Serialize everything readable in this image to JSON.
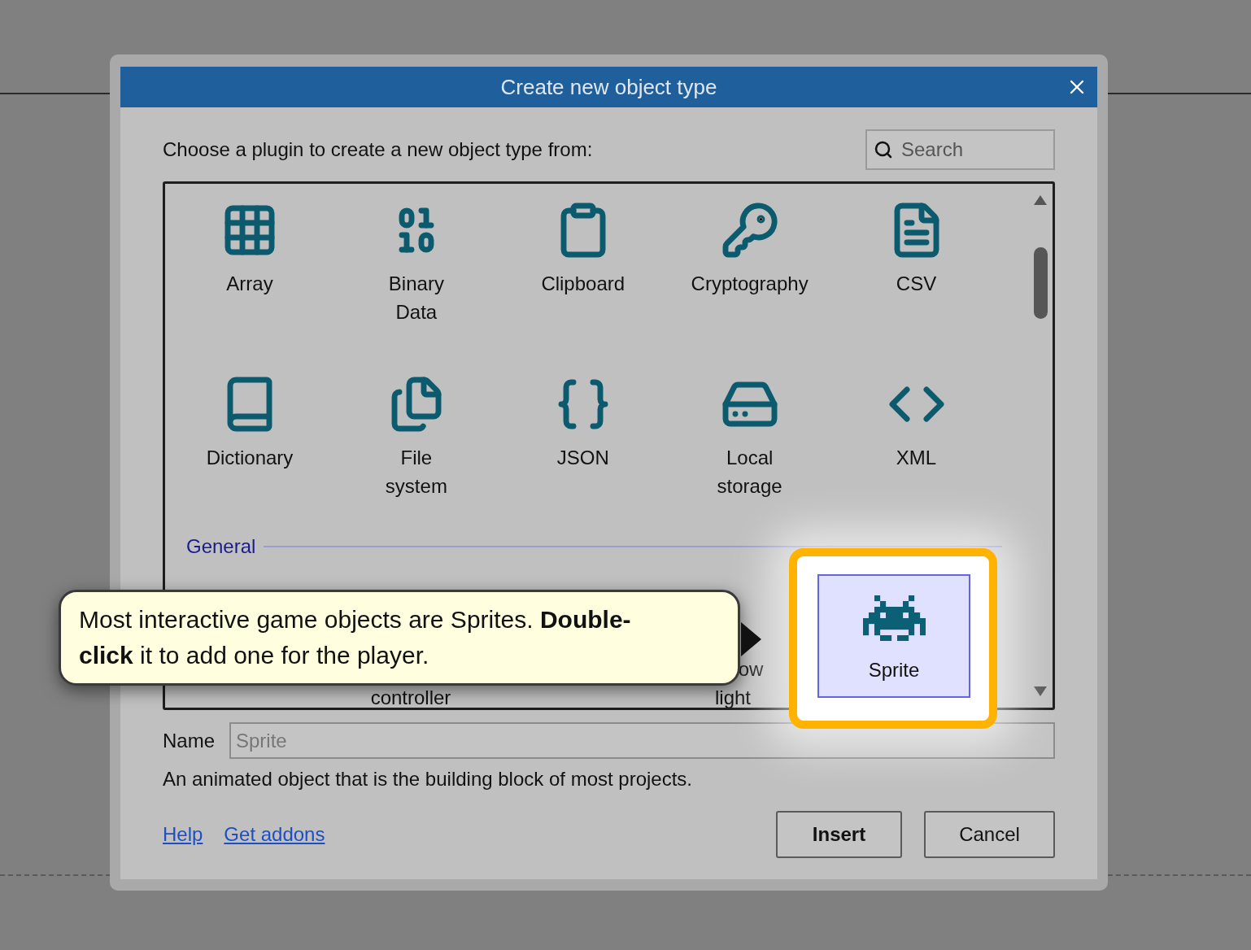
{
  "dialog": {
    "title": "Create new object type",
    "prompt": "Choose a plugin to create a new object type from:",
    "search": {
      "placeholder": "Search"
    },
    "plugins": [
      {
        "lines": [
          "Array"
        ]
      },
      {
        "lines": [
          "Binary",
          "Data"
        ]
      },
      {
        "lines": [
          "Clipboard"
        ]
      },
      {
        "lines": [
          "Cryptography"
        ]
      },
      {
        "lines": [
          "CSV"
        ]
      },
      {
        "lines": [
          "Dictionary"
        ]
      },
      {
        "lines": [
          "File",
          "system"
        ]
      },
      {
        "lines": [
          "JSON"
        ]
      },
      {
        "lines": [
          "Local",
          "storage"
        ]
      },
      {
        "lines": [
          "XML"
        ]
      }
    ],
    "general": {
      "heading": "General",
      "items": [
        {
          "kind": "covered",
          "lines": [
            "controller"
          ]
        },
        {
          "kind": "covered",
          "lines": [
            "ow",
            "light"
          ]
        },
        {
          "kind": "plugin",
          "lines": [
            "Sprite"
          ],
          "selected": true
        }
      ]
    },
    "name": {
      "label": "Name",
      "value": "Sprite"
    },
    "description": "An animated object that is the building block of most projects.",
    "links": [
      "Help",
      "Get addons"
    ],
    "buttons": [
      {
        "label": "Insert",
        "default": true
      },
      {
        "label": "Cancel",
        "default": false
      }
    ]
  },
  "tooltip": {
    "text": "Most interactive game objects are Sprites. **Double-click** it to add one for the player."
  }
}
